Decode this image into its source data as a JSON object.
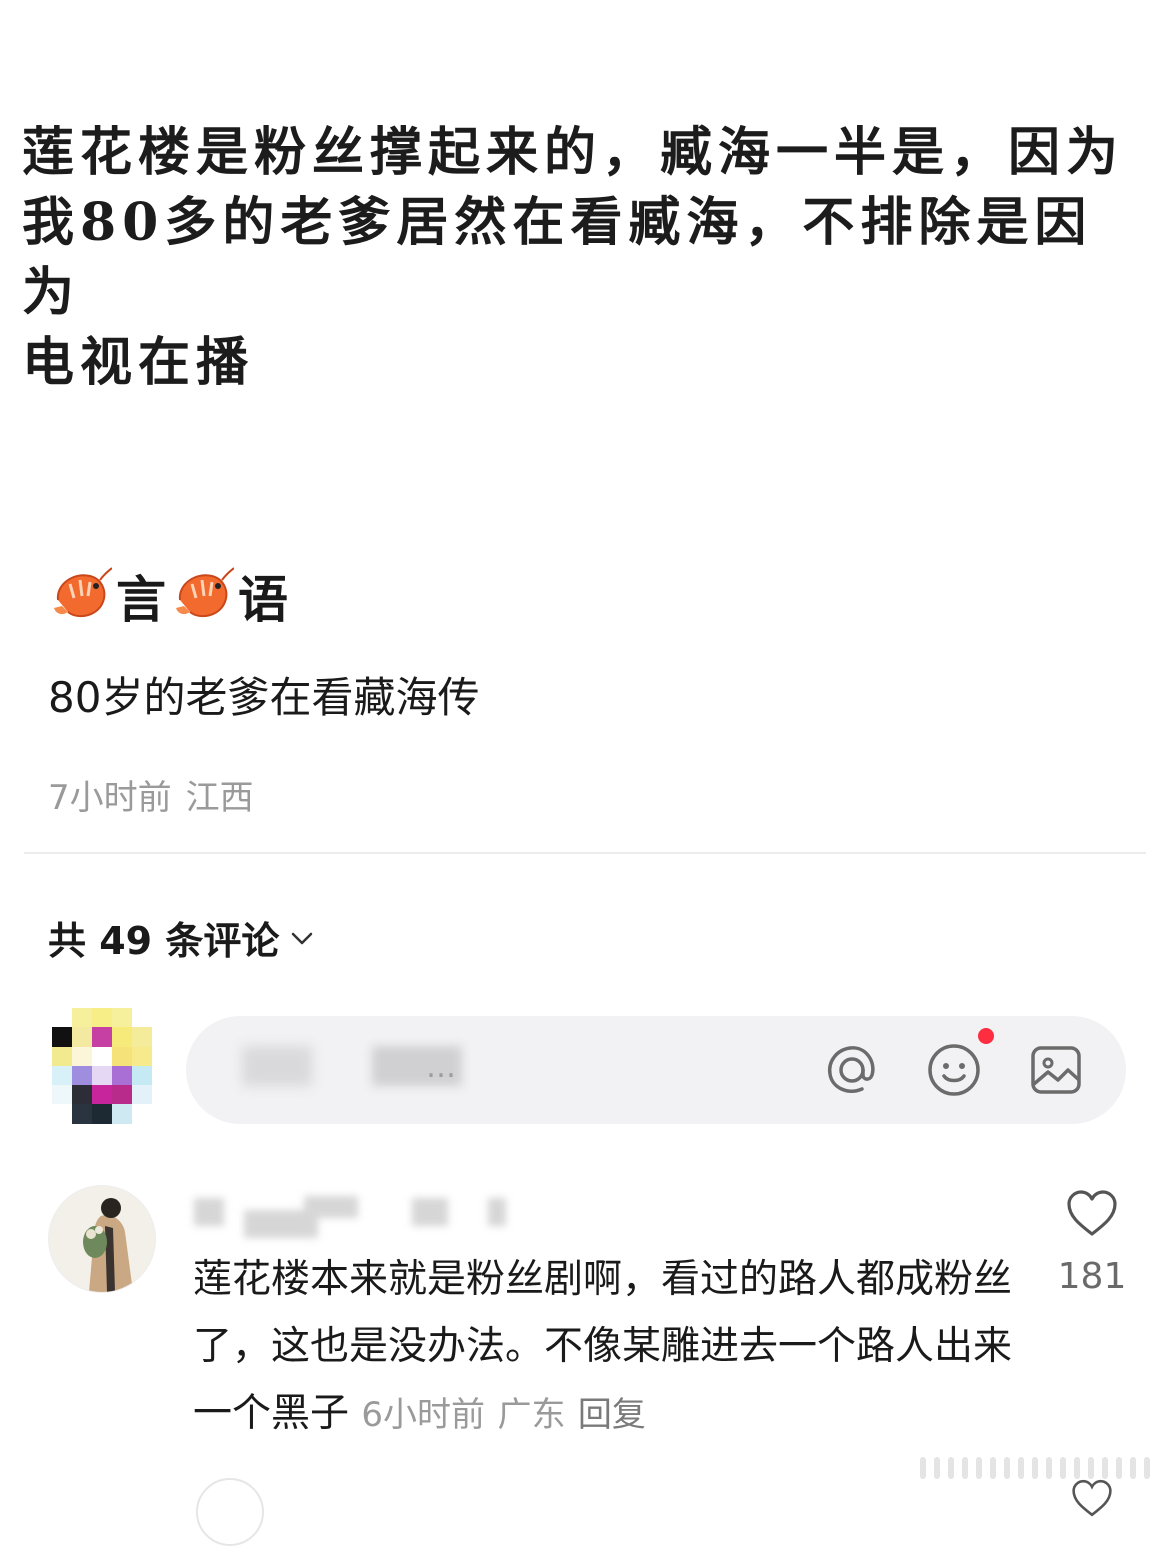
{
  "quote_image": {
    "lines": [
      "莲花楼是粉丝撑起来的，臧海一半是，因为",
      "我80多的老爹居然在看臧海，不排除是因为",
      "电视在播"
    ]
  },
  "post": {
    "author_char_1": "言",
    "author_char_2": "语",
    "author_emoji": "shrimp-icon",
    "text": "80岁的老爹在看藏海传",
    "time": "7小时前",
    "location": "江西"
  },
  "comments_header": {
    "label": "共 49 条评论"
  },
  "comment_input": {
    "placeholder": "…"
  },
  "comments": [
    {
      "text": "莲花楼本来就是粉丝剧啊，看过的路人都成粉丝了，这也是没办法。不像某雕进去一个路人出来一个黑子",
      "time": "6小时前",
      "location": "广东",
      "reply_label": "回复",
      "likes": "181"
    }
  ],
  "colors": {
    "meta_gray": "#9a9a9a",
    "notification_red": "#ff2d40",
    "input_bg": "#f2f2f4"
  }
}
